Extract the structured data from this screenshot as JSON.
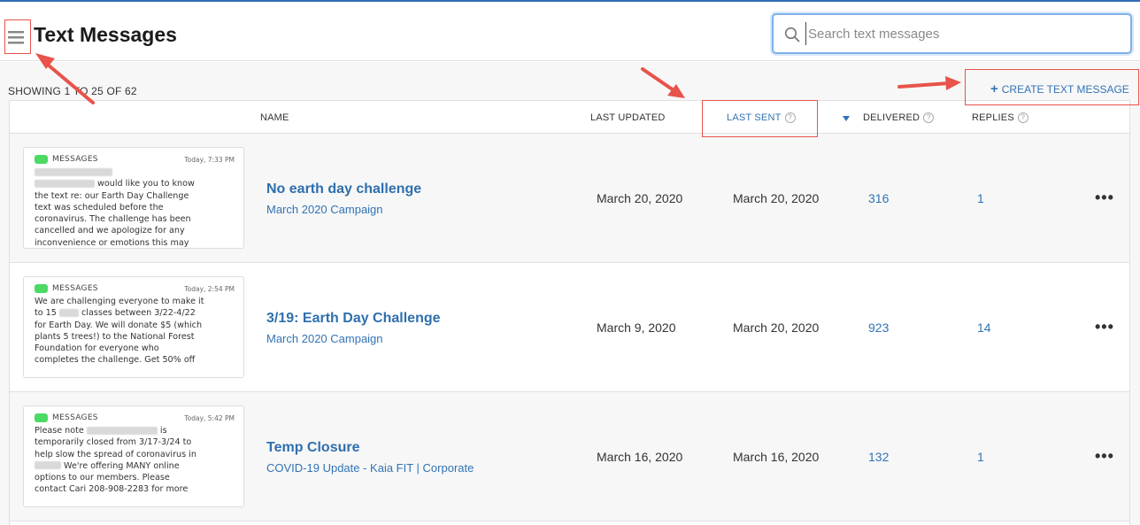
{
  "header": {
    "title": "Text Messages",
    "search_placeholder": "Search text messages"
  },
  "toolbar": {
    "showing": "SHOWING 1 TO 25 OF 62",
    "create_label": "CREATE TEXT MESSAGE",
    "create_plus": "+"
  },
  "columns": {
    "name": "NAME",
    "last_updated": "LAST UPDATED",
    "last_sent": "LAST SENT",
    "delivered": "DELIVERED",
    "replies": "REPLIES",
    "help": "?"
  },
  "rows": [
    {
      "preview": {
        "app": "MESSAGES",
        "time": "Today, 7:33 PM",
        "lines": [
          "",
          " would like you to know",
          "the text re: our Earth Day Challenge",
          "text was scheduled before the",
          "coronavirus. The challenge has been",
          "cancelled and we apologize for any",
          "inconvenience or emotions this may"
        ]
      },
      "title": "No earth day challenge",
      "campaign": "March 2020 Campaign",
      "last_updated": "March 20, 2020",
      "last_sent": "March 20, 2020",
      "delivered": "316",
      "replies": "1"
    },
    {
      "preview": {
        "app": "MESSAGES",
        "time": "Today, 2:54 PM",
        "lines": [
          "We are challenging everyone to make it",
          "to 15 ",
          " classes between 3/22-4/22",
          "for Earth Day. We will donate $5 (which",
          "plants 5 trees!) to the National Forest",
          "Foundation for everyone who",
          "completes the challenge. Get 50% off"
        ]
      },
      "title": "3/19: Earth Day Challenge",
      "campaign": "March 2020 Campaign",
      "last_updated": "March 9, 2020",
      "last_sent": "March 20, 2020",
      "delivered": "923",
      "replies": "14"
    },
    {
      "preview": {
        "app": "MESSAGES",
        "time": "Today, 5:42 PM",
        "lines": [
          "Please note ",
          " is",
          "temporarily closed from 3/17-3/24 to",
          "help slow the spread of coronavirus in",
          " We're offering MANY online",
          "options to our members. Please",
          "contact Cari 208-908-2283 for more"
        ]
      },
      "title": "Temp Closure",
      "campaign": "COVID-19 Update - Kaia FIT | Corporate",
      "last_updated": "March 16, 2020",
      "last_sent": "March 16, 2020",
      "delivered": "132",
      "replies": "1"
    }
  ],
  "row_menu": "•••",
  "colors": {
    "accent": "#3273b5",
    "annotation": "#e8534a",
    "message_icon": "#4cd964"
  }
}
